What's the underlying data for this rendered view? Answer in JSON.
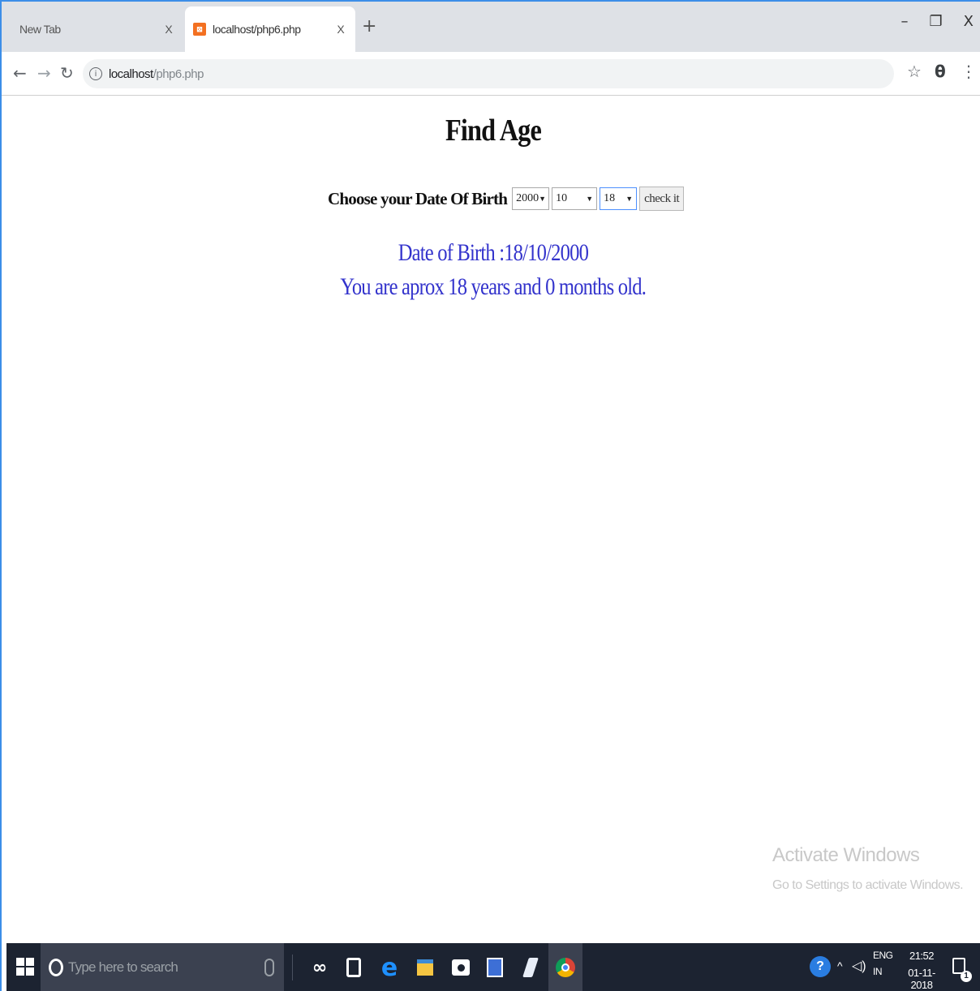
{
  "browser": {
    "tabs": [
      {
        "label": "New Tab",
        "close": "X"
      },
      {
        "label": "localhost/php6.php",
        "close": "X",
        "favicon": "xampp-favicon"
      }
    ],
    "new_tab": "+",
    "window_controls": {
      "minimize": "–",
      "restore": "❐",
      "close": "X"
    },
    "url": {
      "host": "localhost",
      "path": "/php6.php"
    }
  },
  "page": {
    "title": "Find Age",
    "form_label": "Choose your Date Of Birth",
    "year_value": "2000",
    "month_value": "10",
    "day_value": "18",
    "submit_label": "check it",
    "result_dob": "Date of Birth :18/10/2000",
    "result_age": "You are aprox 18 years and 0 months old."
  },
  "watermark": {
    "line1": "Activate Windows",
    "line2": "Go to Settings to activate Windows."
  },
  "taskbar": {
    "search_placeholder": "Type here to search",
    "language": "ENG",
    "region": "IN",
    "time": "21:52",
    "date": "01-11-2018",
    "notification_count": "1"
  },
  "colors": {
    "result_text": "#3333cc",
    "taskbar_bg": "#1c2331",
    "tab_strip_bg": "#dee1e6",
    "frame_border": "#3c8ee8"
  }
}
